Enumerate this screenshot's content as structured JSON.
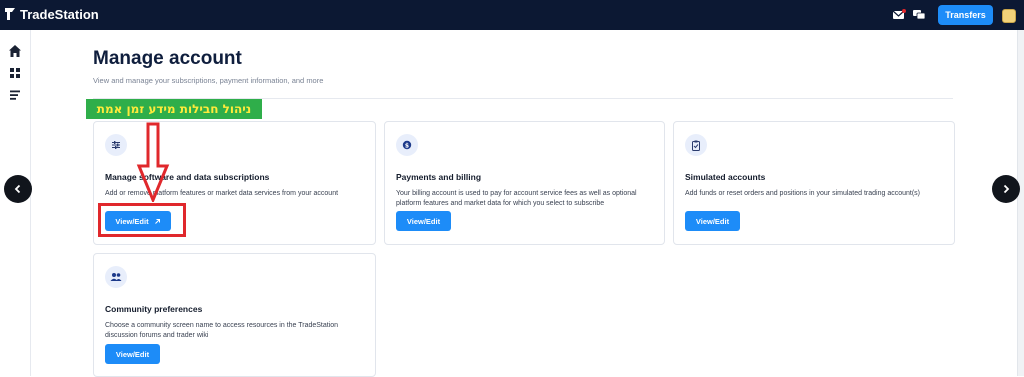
{
  "app": {
    "brand": "TradeStation"
  },
  "header": {
    "transfers_label": "Transfers"
  },
  "page": {
    "title": "Manage account",
    "subtitle": "View and manage your subscriptions, payment information, and more"
  },
  "annotation": {
    "banner_text": "ניהול חבילות מידע זמן אמת"
  },
  "cards": [
    {
      "title": "Manage software and data subscriptions",
      "description": "Add or remove platform features or market data services from your account",
      "button": "View/Edit",
      "icon": "sliders-icon"
    },
    {
      "title": "Payments and billing",
      "description": "Your billing account is used to pay for account service fees as well as optional platform features and market data for which you select to subscribe",
      "button": "View/Edit",
      "icon": "dollar-icon"
    },
    {
      "title": "Simulated accounts",
      "description": "Add funds or reset orders and positions in your simulated trading account(s)",
      "button": "View/Edit",
      "icon": "clipboard-icon"
    },
    {
      "title": "Community preferences",
      "description": "Choose a community screen name to access resources in the TradeStation discussion forums and trader wiki",
      "button": "View/Edit",
      "icon": "people-icon"
    }
  ],
  "colors": {
    "topbar": "#0c1833",
    "accent": "#1d8cf8",
    "annotation_red": "#e0282c",
    "banner_green": "#2fae4a",
    "banner_text": "#ffeb3b"
  }
}
